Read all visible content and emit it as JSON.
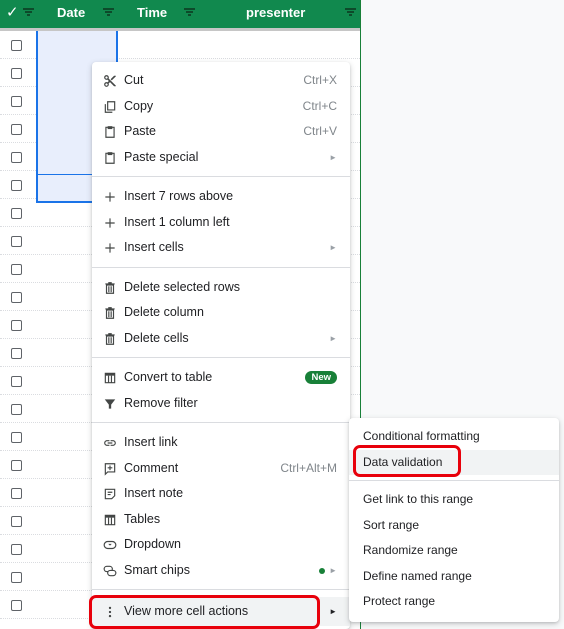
{
  "table": {
    "header": {
      "check_label": "✓",
      "columns": [
        "Date",
        "Time",
        "presenter"
      ]
    },
    "row_count": 21,
    "selected_range_rows": 6
  },
  "context_menu": {
    "groups": [
      [
        {
          "label": "Cut",
          "icon": "scissors-icon",
          "shortcut": "Ctrl+X"
        },
        {
          "label": "Copy",
          "icon": "copy-icon",
          "shortcut": "Ctrl+C"
        },
        {
          "label": "Paste",
          "icon": "clipboard-icon",
          "shortcut": "Ctrl+V"
        },
        {
          "label": "Paste special",
          "icon": "clipboard-icon",
          "submenu": true
        }
      ],
      [
        {
          "label": "Insert 7 rows above",
          "icon": "plus-icon"
        },
        {
          "label": "Insert 1 column left",
          "icon": "plus-icon"
        },
        {
          "label": "Insert cells",
          "icon": "plus-icon",
          "submenu": true
        }
      ],
      [
        {
          "label": "Delete selected rows",
          "icon": "trash-icon"
        },
        {
          "label": "Delete column",
          "icon": "trash-icon"
        },
        {
          "label": "Delete cells",
          "icon": "trash-icon",
          "submenu": true
        }
      ],
      [
        {
          "label": "Convert to table",
          "icon": "table-icon",
          "badge": "New"
        },
        {
          "label": "Remove filter",
          "icon": "filter-icon"
        }
      ],
      [
        {
          "label": "Insert link",
          "icon": "link-icon"
        },
        {
          "label": "Comment",
          "icon": "comment-icon",
          "shortcut": "Ctrl+Alt+M"
        },
        {
          "label": "Insert note",
          "icon": "note-icon"
        },
        {
          "label": "Tables",
          "icon": "table-icon"
        },
        {
          "label": "Dropdown",
          "icon": "dropdown-icon"
        },
        {
          "label": "Smart chips",
          "icon": "smart-chips-icon",
          "submenu": true,
          "dot": true
        }
      ],
      [
        {
          "label": "View more cell actions",
          "icon": "more-vert-icon",
          "submenu": true,
          "highlighted": true
        }
      ]
    ]
  },
  "submenu": {
    "groups": [
      [
        {
          "label": "Conditional formatting"
        },
        {
          "label": "Data validation",
          "highlighted": true
        }
      ],
      [
        {
          "label": "Get link to this range"
        },
        {
          "label": "Sort range"
        },
        {
          "label": "Randomize range"
        },
        {
          "label": "Define named range"
        },
        {
          "label": "Protect range"
        }
      ]
    ]
  },
  "colors": {
    "header_green": "#11894e",
    "selection_blue": "#1a73e8",
    "badge_green": "#188038",
    "annotation_red": "#e8000b"
  }
}
